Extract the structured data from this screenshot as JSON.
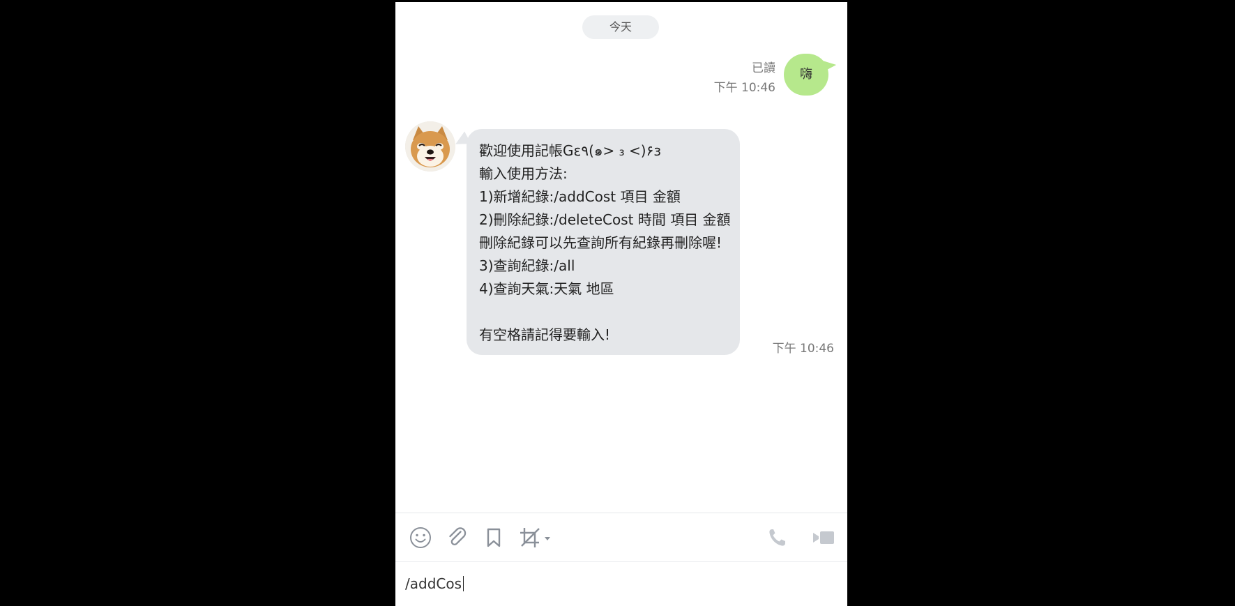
{
  "chat": {
    "date_separator": "今天",
    "sent_message": {
      "text": "嗨",
      "read_status": "已讀",
      "time": "下午 10:46"
    },
    "received_message": {
      "lines": [
        "歡迎使用記帳Gε٩(๑> ₃ <)۶з",
        "輸入使用方法:",
        "1)新增紀錄:/addCost 項目 金額",
        "2)刪除紀錄:/deleteCost 時間 項目 金額",
        "刪除紀錄可以先查詢所有紀錄再刪除喔!",
        "3)查詢紀錄:/all",
        "4)查詢天氣:天氣 地區",
        "",
        "有空格請記得要輸入!"
      ],
      "time": "下午 10:46"
    }
  },
  "toolbar": {
    "icons": [
      "emoji-icon",
      "attach-icon",
      "bookmark-icon",
      "screenshot-crop-icon",
      "phone-icon",
      "video-icon"
    ]
  },
  "input": {
    "value": "/addCos"
  },
  "colors": {
    "sent_bubble": "#b6e88c",
    "received_bubble": "#e5e7ea",
    "background": "#000000"
  }
}
